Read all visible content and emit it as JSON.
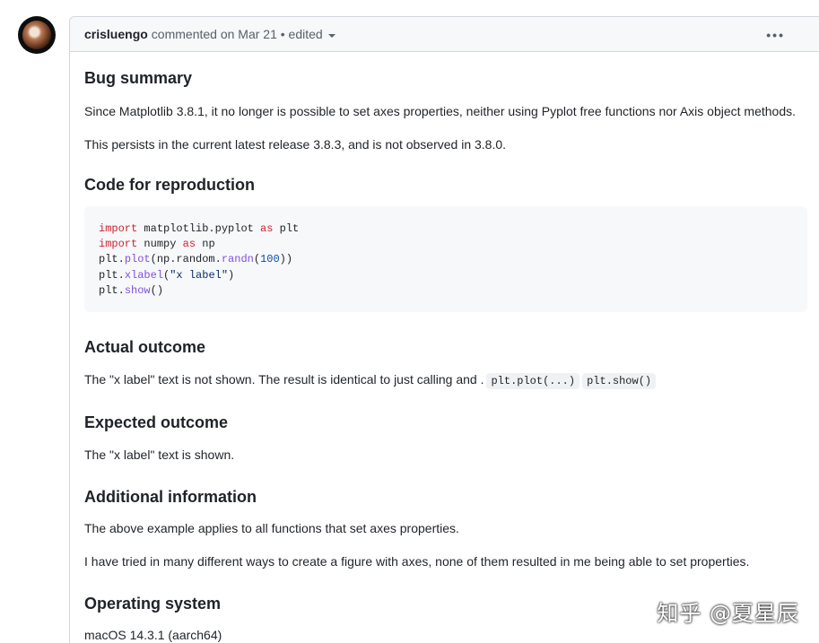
{
  "comment": {
    "author": "crisluengo",
    "meta": "commented on Mar 21 • edited"
  },
  "sections": {
    "bug_summary": {
      "heading": "Bug summary",
      "p1": "Since Matplotlib 3.8.1, it no longer is possible to set axes properties, neither using Pyplot free functions nor Axis object methods.",
      "p2": "This persists in the current latest release 3.8.3, and is not observed in 3.8.0."
    },
    "code": {
      "heading": "Code for reproduction",
      "lines": [
        [
          {
            "t": "import",
            "c": "kw"
          },
          {
            "t": " matplotlib.pyplot "
          },
          {
            "t": "as",
            "c": "kw"
          },
          {
            "t": " plt"
          }
        ],
        [
          {
            "t": "import",
            "c": "kw"
          },
          {
            "t": " numpy "
          },
          {
            "t": "as",
            "c": "kw"
          },
          {
            "t": " np"
          }
        ],
        [
          {
            "t": "plt."
          },
          {
            "t": "plot",
            "c": "fn"
          },
          {
            "t": "(np.random."
          },
          {
            "t": "randn",
            "c": "fn"
          },
          {
            "t": "("
          },
          {
            "t": "100",
            "c": "num"
          },
          {
            "t": "))"
          }
        ],
        [
          {
            "t": "plt."
          },
          {
            "t": "xlabel",
            "c": "fn"
          },
          {
            "t": "("
          },
          {
            "t": "\"x label\"",
            "c": "str"
          },
          {
            "t": ")"
          }
        ],
        [
          {
            "t": "plt."
          },
          {
            "t": "show",
            "c": "fn"
          },
          {
            "t": "()"
          }
        ]
      ]
    },
    "actual": {
      "heading": "Actual outcome",
      "text": "The \"x label\" text is not shown. The result is identical to just calling and .",
      "code1": "plt.plot(...)",
      "code2": "plt.show()"
    },
    "expected": {
      "heading": "Expected outcome",
      "text": "The \"x label\" text is shown."
    },
    "additional": {
      "heading": "Additional information",
      "p1": "The above example applies to all functions that set axes properties.",
      "p2": "I have tried in many different ways to create a figure with axes, none of them resulted in me being able to set properties."
    },
    "os": {
      "heading": "Operating system",
      "text": "macOS 14.3.1 (aarch64)"
    }
  },
  "watermark": "知乎 @夏星辰",
  "colors": {
    "keyword": "#cf222e",
    "function": "#8250df",
    "number": "#0550ae",
    "string": "#0a3069",
    "header_bg": "#f6f8fa",
    "border": "#d0d7de"
  }
}
